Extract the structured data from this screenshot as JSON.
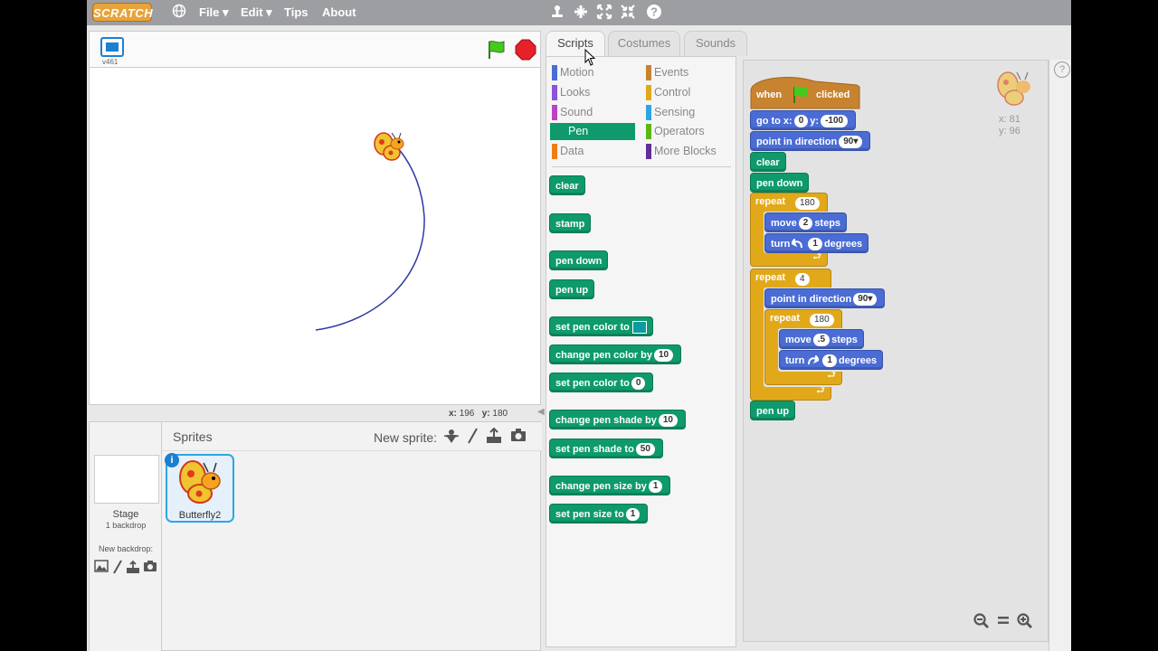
{
  "menubar": {
    "logo": "SCRATCH",
    "file": "File ▾",
    "edit": "Edit ▾",
    "tips": "Tips",
    "about": "About"
  },
  "stage": {
    "version": "v461",
    "coords_x_label": "x:",
    "coords_x": "196",
    "coords_y_label": "y:",
    "coords_y": "180"
  },
  "tabs": [
    {
      "label": "Scripts"
    },
    {
      "label": "Costumes"
    },
    {
      "label": "Sounds"
    }
  ],
  "categories": [
    {
      "label": "Motion",
      "color": "#4a6cd4"
    },
    {
      "label": "Events",
      "color": "#c88330"
    },
    {
      "label": "Looks",
      "color": "#8a55d7"
    },
    {
      "label": "Control",
      "color": "#e1a91a"
    },
    {
      "label": "Sound",
      "color": "#bb42c3"
    },
    {
      "label": "Sensing",
      "color": "#2ca5e2"
    },
    {
      "label": "Pen",
      "color": "#0e9a6c"
    },
    {
      "label": "Operators",
      "color": "#5cb712"
    },
    {
      "label": "Data",
      "color": "#ee7d16"
    },
    {
      "label": "More Blocks",
      "color": "#632d99"
    }
  ],
  "palette": {
    "clear": "clear",
    "stamp": "stamp",
    "pen_down": "pen down",
    "pen_up": "pen up",
    "set_pen_color_to": "set pen color to",
    "change_pen_color_by": "change pen color by",
    "change_pen_color_by_val": "10",
    "set_pen_color_to2": "set pen color to",
    "set_pen_color_to2_val": "0",
    "change_pen_shade_by": "change pen shade by",
    "change_pen_shade_by_val": "10",
    "set_pen_shade_to": "set pen shade to",
    "set_pen_shade_to_val": "50",
    "change_pen_size_by": "change pen size by",
    "change_pen_size_by_val": "1",
    "set_pen_size_to": "set pen size to",
    "set_pen_size_to_val": "1"
  },
  "script": {
    "when": "when",
    "clicked": "clicked",
    "go_to_x": "go to x:",
    "x_val": "0",
    "y_label": "y:",
    "y_val": "-100",
    "point_in_direction": "point in direction",
    "direction_val": "90▾",
    "clear": "clear",
    "pen_down": "pen down",
    "repeat": "repeat",
    "repeat1_val": "180",
    "move": "move",
    "move1_val": "2",
    "steps": "steps",
    "turn": "turn",
    "turn1_val": "1",
    "degrees": "degrees",
    "repeat2_val": "4",
    "point2_direction_val": "90▾",
    "repeat3_val": "180",
    "move2_val": ".5",
    "turn2_val": "1",
    "pen_up": "pen up"
  },
  "sprite_info": {
    "x_label": "x:",
    "x": "81",
    "y_label": "y:",
    "y": "96"
  },
  "sprites_panel": {
    "title": "Sprites",
    "new_sprite": "New sprite:",
    "stage_label": "Stage",
    "backdrop_count": "1 backdrop",
    "new_backdrop": "New backdrop:",
    "sprite_name": "Butterfly2",
    "info": "i"
  },
  "help": "?"
}
